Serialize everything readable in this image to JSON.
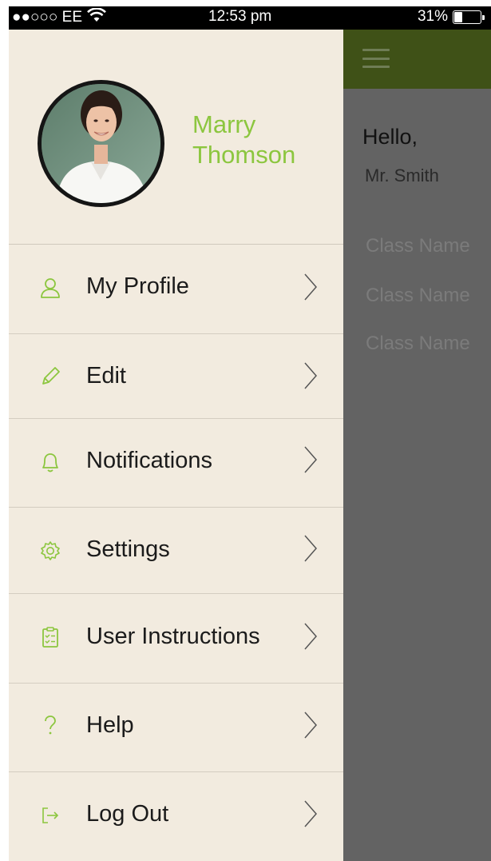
{
  "status_bar": {
    "carrier": "●●○○○ EE",
    "time": "12:53 pm",
    "battery": "31%",
    "battery_level": 0.31
  },
  "drawer": {
    "profile": {
      "first_name": "Marry",
      "last_name": "Thomson",
      "avatar_icon": "teacher-photo"
    },
    "menu": [
      {
        "label": "My Profile",
        "icon": "user-icon"
      },
      {
        "label": "Edit",
        "icon": "pencil-icon"
      },
      {
        "label": "Notifications",
        "icon": "bell-icon"
      },
      {
        "label": "Settings",
        "icon": "gear-icon"
      },
      {
        "label": "User Instructions",
        "icon": "clipboard-checklist-icon"
      },
      {
        "label": "Help",
        "icon": "question-icon"
      },
      {
        "label": "Log Out",
        "icon": "logout-icon"
      }
    ]
  },
  "main": {
    "greeting": "Hello,",
    "teacher": "Mr. Smith",
    "classes": [
      "Class Name",
      "Class Name",
      "Class Name"
    ]
  },
  "colors": {
    "accent": "#8cc63f",
    "header": "#3f5117",
    "drawer_bg": "#f2ebdf",
    "overlay": "#636363"
  }
}
